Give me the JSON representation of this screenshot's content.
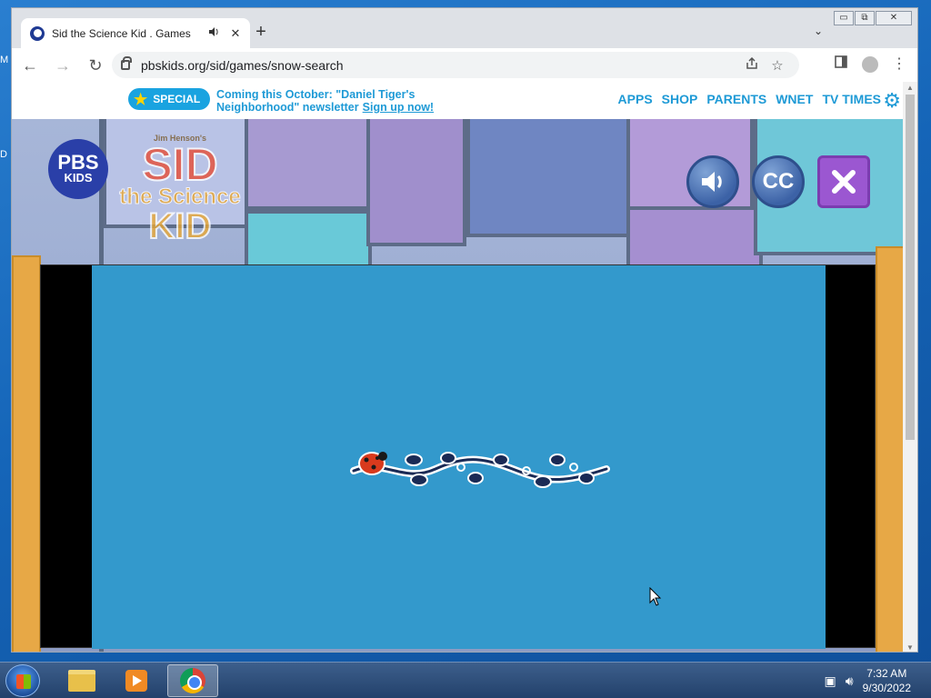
{
  "desktop": {
    "stub_top": "M",
    "stub_mid": "D"
  },
  "tab": {
    "title": "Sid the Science Kid . Games",
    "audio_icon": "speaker-icon",
    "close": "✕"
  },
  "tabstrip": {
    "newtab": "+",
    "search": "⌄"
  },
  "window_controls": {
    "minimize": "▭",
    "restore": "⧉",
    "close": "✕"
  },
  "toolbar": {
    "back": "←",
    "forward": "→",
    "reload": "↻",
    "url": "pbskids.org/sid/games/snow-search"
  },
  "pbs_bar": {
    "special_label": "SPECIAL",
    "promo_line1": "Coming this October: \"Daniel Tiger's",
    "promo_line2": "Neighborhood\" newsletter",
    "promo_link": "Sign up now!",
    "nav": [
      "APPS",
      "SHOP",
      "PARENTS",
      "WNET",
      "TV TIMES"
    ]
  },
  "game": {
    "pbs_logo_line1": "PBS",
    "pbs_logo_line2": "KIDS",
    "sid_logo_top": "Jim Henson's",
    "sid_logo_sid": "SID",
    "sid_logo_science": "the Science",
    "sid_logo_kid": "KID",
    "cc_label": "CC"
  },
  "taskbar": {
    "time": "7:32 AM",
    "date": "9/30/2022"
  },
  "colors": {
    "pbs_blue": "#1e9ad6",
    "game_bg": "#3399cc",
    "close_purple": "#9b57d1"
  }
}
